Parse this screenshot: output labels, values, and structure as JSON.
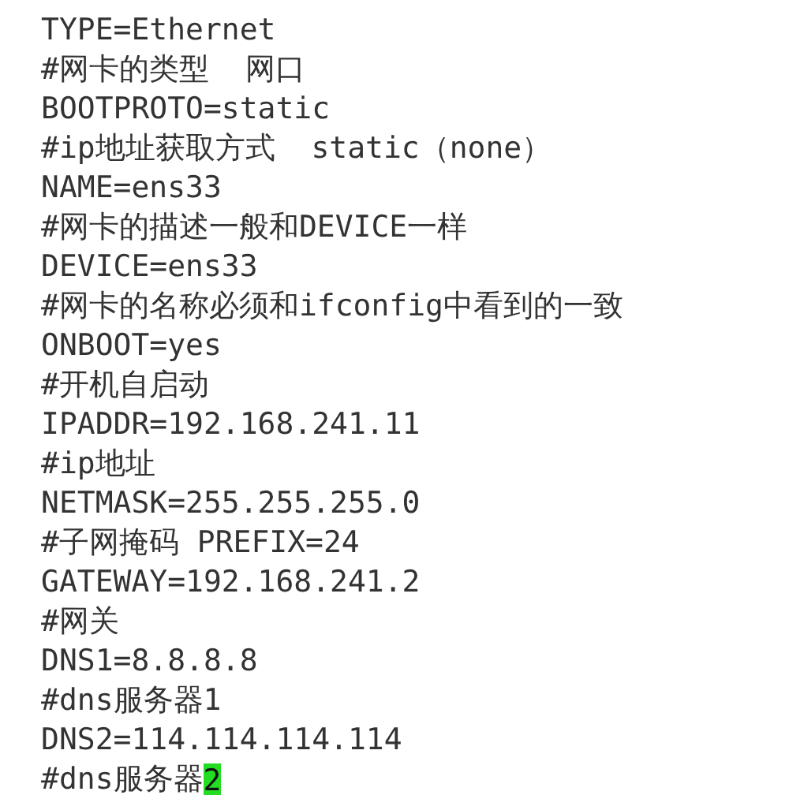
{
  "editor": {
    "lines": [
      {
        "text": "TYPE=Ethernet"
      },
      {
        "text": "#网卡的类型  网口"
      },
      {
        "text": "BOOTPROTO=static"
      },
      {
        "text": "#ip地址获取方式  static（none）"
      },
      {
        "text": "NAME=ens33"
      },
      {
        "text": "#网卡的描述一般和DEVICE一样"
      },
      {
        "text": "DEVICE=ens33"
      },
      {
        "text": "#网卡的名称必须和ifconfig中看到的一致"
      },
      {
        "text": "ONBOOT=yes"
      },
      {
        "text": "#开机自启动"
      },
      {
        "text": "IPADDR=192.168.241.11"
      },
      {
        "text": "#ip地址"
      },
      {
        "text": "NETMASK=255.255.255.0"
      },
      {
        "text": "#子网掩码 PREFIX=24"
      },
      {
        "text": "GATEWAY=192.168.241.2"
      },
      {
        "text": "#网关"
      },
      {
        "text": "DNS1=8.8.8.8"
      },
      {
        "text": "#dns服务器1"
      },
      {
        "text": "DNS2=114.114.114.114"
      },
      {
        "text": "#dns服务器",
        "cursor": "2"
      }
    ]
  }
}
